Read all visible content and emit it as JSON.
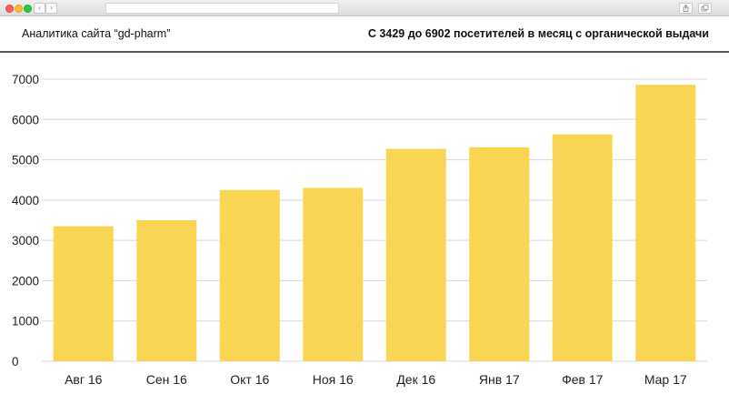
{
  "browser": {
    "back_icon": "chevron-left-icon",
    "forward_icon": "chevron-right-icon",
    "share_icon": "share-icon",
    "tabs_icon": "tabs-icon"
  },
  "header": {
    "title": "Аналитика сайта “gd-pharm”",
    "summary": "С 3429 до 6902 посетителей в месяц с органической выдачи"
  },
  "chart_data": {
    "type": "bar",
    "title": "",
    "xlabel": "",
    "ylabel": "",
    "categories": [
      "Авг 16",
      "Сен 16",
      "Окт 16",
      "Ноя 16",
      "Дек 16",
      "Янв 17",
      "Фев 17",
      "Мар 17"
    ],
    "values": [
      3350,
      3500,
      4250,
      4300,
      5270,
      5310,
      5630,
      6860
    ],
    "ylim": [
      0,
      7000
    ],
    "yticks": [
      0,
      1000,
      2000,
      3000,
      4000,
      5000,
      6000,
      7000
    ],
    "grid": true,
    "legend": "none",
    "bar_color": "#f8d653",
    "axis_text_color": "#222222",
    "grid_color": "#d9d9d9"
  }
}
